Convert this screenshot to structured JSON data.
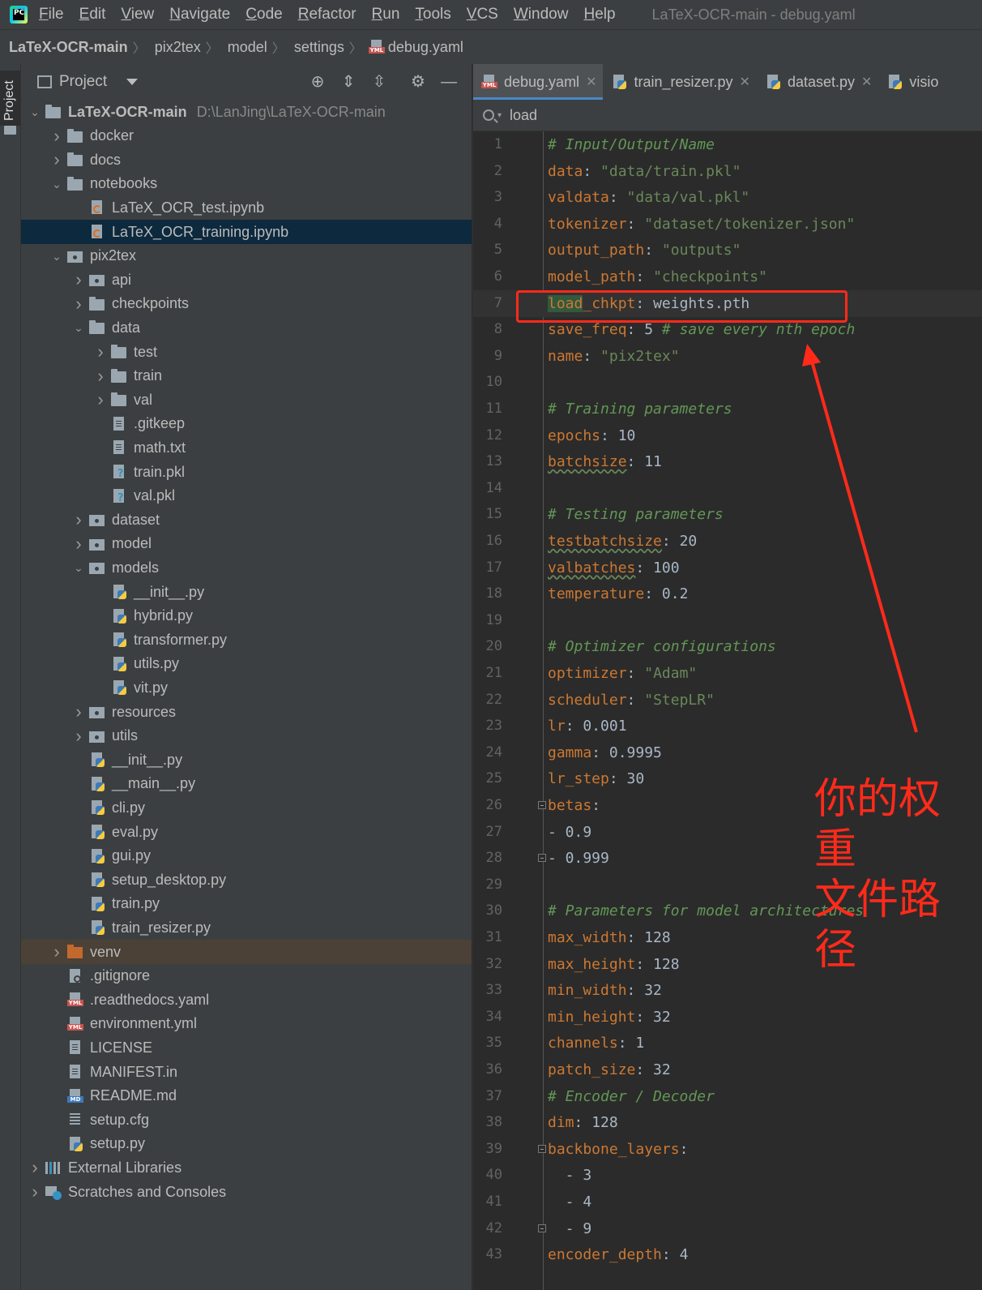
{
  "menubar": {
    "app_icon": "pycharm-logo",
    "app_icon_text": "PC",
    "items": [
      "File",
      "Edit",
      "View",
      "Navigate",
      "Code",
      "Refactor",
      "Run",
      "Tools",
      "VCS",
      "Window",
      "Help"
    ],
    "window_title": "LaTeX-OCR-main - debug.yaml"
  },
  "breadcrumb": [
    "LaTeX-OCR-main",
    "pix2tex",
    "model",
    "settings",
    "debug.yaml"
  ],
  "left_strip": {
    "tab": "Project"
  },
  "project_panel": {
    "title": "Project",
    "tools": [
      "locate-icon",
      "expand-all-icon",
      "collapse-all-icon",
      "gear-icon",
      "minimize-icon"
    ],
    "tree": [
      {
        "depth": 0,
        "name": "LaTeX-OCR-main",
        "path": "D:\\LanJing\\LaTeX-OCR-main",
        "icon": "folder",
        "expanded": true,
        "bold": true
      },
      {
        "depth": 1,
        "name": "docker",
        "icon": "folder",
        "expanded": false
      },
      {
        "depth": 1,
        "name": "docs",
        "icon": "folder",
        "expanded": false
      },
      {
        "depth": 1,
        "name": "notebooks",
        "icon": "folder",
        "expanded": true
      },
      {
        "depth": 2,
        "name": "LaTeX_OCR_test.ipynb",
        "icon": "nb"
      },
      {
        "depth": 2,
        "name": "LaTeX_OCR_training.ipynb",
        "icon": "nb",
        "selected": true
      },
      {
        "depth": 1,
        "name": "pix2tex",
        "icon": "pkg",
        "expanded": true
      },
      {
        "depth": 2,
        "name": "api",
        "icon": "pkg",
        "expanded": false
      },
      {
        "depth": 2,
        "name": "checkpoints",
        "icon": "folder",
        "expanded": false
      },
      {
        "depth": 2,
        "name": "data",
        "icon": "folder",
        "expanded": true
      },
      {
        "depth": 3,
        "name": "test",
        "icon": "folder",
        "expanded": false
      },
      {
        "depth": 3,
        "name": "train",
        "icon": "folder",
        "expanded": false
      },
      {
        "depth": 3,
        "name": "val",
        "icon": "folder",
        "expanded": false
      },
      {
        "depth": 3,
        "name": ".gitkeep",
        "icon": "file"
      },
      {
        "depth": 3,
        "name": "math.txt",
        "icon": "file"
      },
      {
        "depth": 3,
        "name": "train.pkl",
        "icon": "pkl"
      },
      {
        "depth": 3,
        "name": "val.pkl",
        "icon": "pkl"
      },
      {
        "depth": 2,
        "name": "dataset",
        "icon": "pkg",
        "expanded": false
      },
      {
        "depth": 2,
        "name": "model",
        "icon": "pkg",
        "expanded": false
      },
      {
        "depth": 2,
        "name": "models",
        "icon": "pkg",
        "expanded": true
      },
      {
        "depth": 3,
        "name": "__init__.py",
        "icon": "py"
      },
      {
        "depth": 3,
        "name": "hybrid.py",
        "icon": "py"
      },
      {
        "depth": 3,
        "name": "transformer.py",
        "icon": "py"
      },
      {
        "depth": 3,
        "name": "utils.py",
        "icon": "py"
      },
      {
        "depth": 3,
        "name": "vit.py",
        "icon": "py"
      },
      {
        "depth": 2,
        "name": "resources",
        "icon": "pkg",
        "expanded": false
      },
      {
        "depth": 2,
        "name": "utils",
        "icon": "pkg",
        "expanded": false
      },
      {
        "depth": 2,
        "name": "__init__.py",
        "icon": "py"
      },
      {
        "depth": 2,
        "name": "__main__.py",
        "icon": "py"
      },
      {
        "depth": 2,
        "name": "cli.py",
        "icon": "py"
      },
      {
        "depth": 2,
        "name": "eval.py",
        "icon": "py"
      },
      {
        "depth": 2,
        "name": "gui.py",
        "icon": "py"
      },
      {
        "depth": 2,
        "name": "setup_desktop.py",
        "icon": "py"
      },
      {
        "depth": 2,
        "name": "train.py",
        "icon": "py"
      },
      {
        "depth": 2,
        "name": "train_resizer.py",
        "icon": "py"
      },
      {
        "depth": 1,
        "name": "venv",
        "icon": "venvf",
        "expanded": false,
        "venv": true
      },
      {
        "depth": 1,
        "name": ".gitignore",
        "icon": "ign"
      },
      {
        "depth": 1,
        "name": ".readthedocs.yaml",
        "icon": "yml"
      },
      {
        "depth": 1,
        "name": "environment.yml",
        "icon": "yml"
      },
      {
        "depth": 1,
        "name": "LICENSE",
        "icon": "file"
      },
      {
        "depth": 1,
        "name": "MANIFEST.in",
        "icon": "file"
      },
      {
        "depth": 1,
        "name": "README.md",
        "icon": "md"
      },
      {
        "depth": 1,
        "name": "setup.cfg",
        "icon": "cfg"
      },
      {
        "depth": 1,
        "name": "setup.py",
        "icon": "py"
      },
      {
        "depth": 0,
        "name": "External Libraries",
        "icon": "lib",
        "expanded": false
      },
      {
        "depth": 0,
        "name": "Scratches and Consoles",
        "icon": "scr",
        "expanded": false
      }
    ]
  },
  "editor": {
    "tabs": [
      {
        "label": "debug.yaml",
        "icon": "yml",
        "active": true
      },
      {
        "label": "train_resizer.py",
        "icon": "py"
      },
      {
        "label": "dataset.py",
        "icon": "py"
      },
      {
        "label": "visio",
        "icon": "py"
      }
    ],
    "search": {
      "value": "load"
    },
    "current_line": 7,
    "lines": [
      {
        "n": "1",
        "t": [
          [
            "c",
            "# Input/Output/Name"
          ]
        ]
      },
      {
        "n": "2",
        "t": [
          [
            "k",
            "data"
          ],
          [
            "n",
            ": "
          ],
          [
            "s",
            "\"data/train.pkl\""
          ]
        ]
      },
      {
        "n": "3",
        "t": [
          [
            "k",
            "valdata"
          ],
          [
            "n",
            ": "
          ],
          [
            "s",
            "\"data/val.pkl\""
          ]
        ]
      },
      {
        "n": "4",
        "t": [
          [
            "k",
            "tokenizer"
          ],
          [
            "n",
            ": "
          ],
          [
            "s",
            "\"dataset/tokenizer.json\""
          ]
        ]
      },
      {
        "n": "5",
        "t": [
          [
            "k",
            "output_path"
          ],
          [
            "n",
            ": "
          ],
          [
            "s",
            "\"outputs\""
          ]
        ]
      },
      {
        "n": "6",
        "t": [
          [
            "k",
            "model_path"
          ],
          [
            "n",
            ": "
          ],
          [
            "s",
            "\"checkpoints\""
          ]
        ]
      },
      {
        "n": "7",
        "t": [
          [
            "hl",
            "load"
          ],
          [
            "k",
            "_chkpt"
          ],
          [
            "n",
            ": weights.pth"
          ]
        ]
      },
      {
        "n": "8",
        "t": [
          [
            "k",
            "save_freq"
          ],
          [
            "n",
            ": 5 "
          ],
          [
            "c",
            "# save every nth epoch"
          ]
        ]
      },
      {
        "n": "9",
        "t": [
          [
            "k",
            "name"
          ],
          [
            "n",
            ": "
          ],
          [
            "s",
            "\"pix2tex\""
          ]
        ]
      },
      {
        "n": "10",
        "t": []
      },
      {
        "n": "11",
        "t": [
          [
            "c",
            "# Training parameters"
          ]
        ]
      },
      {
        "n": "12",
        "t": [
          [
            "k",
            "epochs"
          ],
          [
            "n",
            ": 10"
          ]
        ]
      },
      {
        "n": "13",
        "t": [
          [
            "ksq",
            "batchsize"
          ],
          [
            "n",
            ": 11"
          ]
        ]
      },
      {
        "n": "14",
        "t": []
      },
      {
        "n": "15",
        "t": [
          [
            "c",
            "# Testing parameters"
          ]
        ]
      },
      {
        "n": "16",
        "t": [
          [
            "ksq",
            "testbatchsize"
          ],
          [
            "n",
            ": 20"
          ]
        ]
      },
      {
        "n": "17",
        "t": [
          [
            "ksq",
            "valbatches"
          ],
          [
            "n",
            ": 100"
          ]
        ]
      },
      {
        "n": "18",
        "t": [
          [
            "k",
            "temperature"
          ],
          [
            "n",
            ": 0.2"
          ]
        ]
      },
      {
        "n": "19",
        "t": []
      },
      {
        "n": "20",
        "t": [
          [
            "c",
            "# Optimizer configurations"
          ]
        ]
      },
      {
        "n": "21",
        "t": [
          [
            "k",
            "optimizer"
          ],
          [
            "n",
            ": "
          ],
          [
            "s",
            "\"Adam\""
          ]
        ]
      },
      {
        "n": "22",
        "t": [
          [
            "k",
            "scheduler"
          ],
          [
            "n",
            ": "
          ],
          [
            "s",
            "\"StepLR\""
          ]
        ]
      },
      {
        "n": "23",
        "t": [
          [
            "k",
            "lr"
          ],
          [
            "n",
            ": 0.001"
          ]
        ]
      },
      {
        "n": "24",
        "t": [
          [
            "k",
            "gamma"
          ],
          [
            "n",
            ": 0.9995"
          ]
        ]
      },
      {
        "n": "25",
        "t": [
          [
            "k",
            "lr_step"
          ],
          [
            "n",
            ": 30"
          ]
        ]
      },
      {
        "n": "26",
        "t": [
          [
            "k",
            "betas"
          ],
          [
            "n",
            ":"
          ]
        ],
        "fold": true
      },
      {
        "n": "27",
        "t": [
          [
            "n",
            "- 0.9"
          ]
        ]
      },
      {
        "n": "28",
        "t": [
          [
            "n",
            "- 0.999"
          ]
        ],
        "fold": true
      },
      {
        "n": "29",
        "t": []
      },
      {
        "n": "30",
        "t": [
          [
            "c",
            "# Parameters for model architectures"
          ]
        ]
      },
      {
        "n": "31",
        "t": [
          [
            "k",
            "max_width"
          ],
          [
            "n",
            ": 128"
          ]
        ]
      },
      {
        "n": "32",
        "t": [
          [
            "k",
            "max_height"
          ],
          [
            "n",
            ": 128"
          ]
        ]
      },
      {
        "n": "33",
        "t": [
          [
            "k",
            "min_width"
          ],
          [
            "n",
            ": 32"
          ]
        ]
      },
      {
        "n": "34",
        "t": [
          [
            "k",
            "min_height"
          ],
          [
            "n",
            ": 32"
          ]
        ]
      },
      {
        "n": "35",
        "t": [
          [
            "k",
            "channels"
          ],
          [
            "n",
            ": 1"
          ]
        ]
      },
      {
        "n": "36",
        "t": [
          [
            "k",
            "patch_size"
          ],
          [
            "n",
            ": 32"
          ]
        ]
      },
      {
        "n": "37",
        "t": [
          [
            "c",
            "# Encoder / Decoder"
          ]
        ]
      },
      {
        "n": "38",
        "t": [
          [
            "k",
            "dim"
          ],
          [
            "n",
            ": 128"
          ]
        ]
      },
      {
        "n": "39",
        "t": [
          [
            "k",
            "backbone_layers"
          ],
          [
            "n",
            ":"
          ]
        ],
        "fold": true
      },
      {
        "n": "40",
        "t": [
          [
            "n",
            "  - 3"
          ]
        ]
      },
      {
        "n": "41",
        "t": [
          [
            "n",
            "  - 4"
          ]
        ]
      },
      {
        "n": "42",
        "t": [
          [
            "n",
            "  - 9"
          ]
        ],
        "fold": true
      },
      {
        "n": "43",
        "t": [
          [
            "k",
            "encoder_depth"
          ],
          [
            "n",
            ": 4"
          ]
        ]
      }
    ]
  },
  "annotation": {
    "text_line1": "你的权重",
    "text_line2": "文件路径",
    "color": "#ff2a1a"
  }
}
